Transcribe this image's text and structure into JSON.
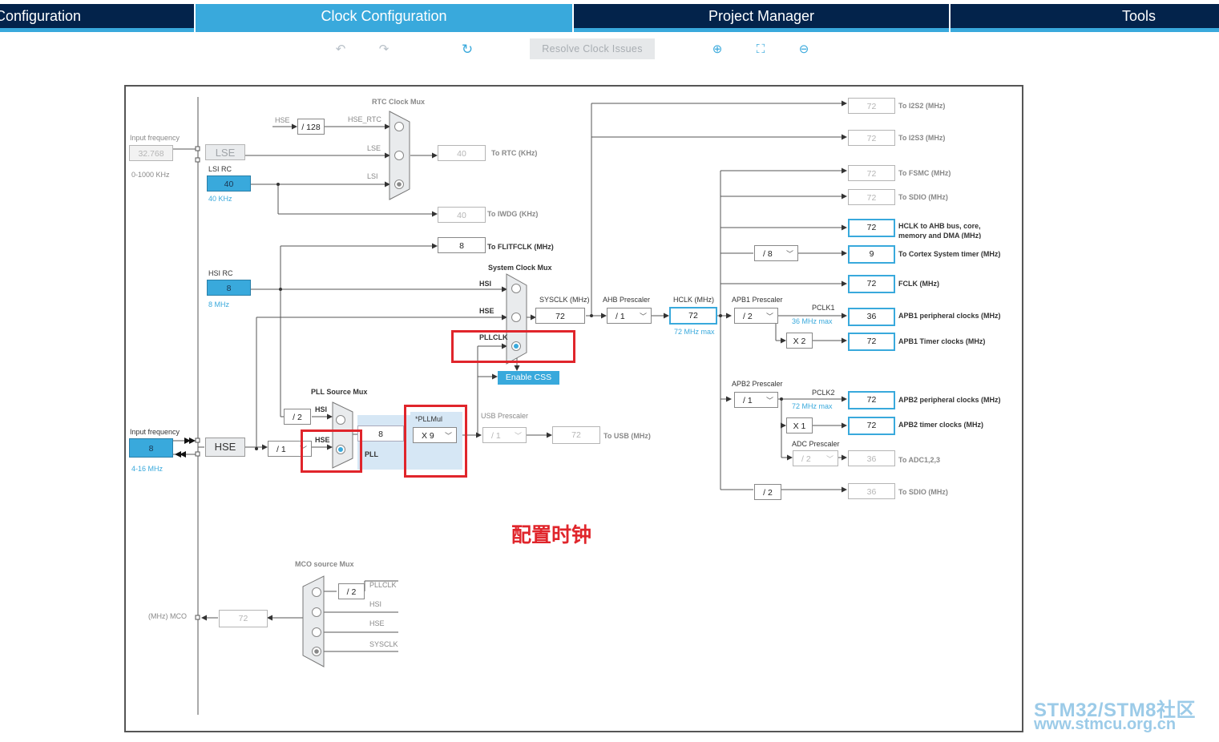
{
  "tabs": [
    {
      "label": "Configuration"
    },
    {
      "label": "Clock Configuration"
    },
    {
      "label": "Project Manager"
    },
    {
      "label": "Tools"
    }
  ],
  "toolbar": {
    "resolve_label": "Resolve Clock Issues",
    "icons": [
      "undo-icon",
      "redo-icon",
      "refresh-icon",
      "zoom-in-icon",
      "fit-screen-icon",
      "zoom-out-icon"
    ]
  },
  "lse": {
    "input_label": "Input frequency",
    "input_value": "32.768",
    "range": "0-1000 KHz",
    "name": "LSE"
  },
  "lsi": {
    "title": "LSI RC",
    "value": "40",
    "freq": "40 KHz"
  },
  "rtc": {
    "title": "RTC Clock Mux",
    "hse_label": "HSE",
    "div": "/ 128",
    "hse_rtc": "HSE_RTC",
    "lse_label": "LSE",
    "lsi_label": "LSI",
    "out_value": "40",
    "out_label": "To RTC (KHz)",
    "iwdg_value": "40",
    "iwdg_label": "To IWDG (KHz)"
  },
  "flitf": {
    "value": "8",
    "label": "To FLITFCLK (MHz)"
  },
  "hsi": {
    "title": "HSI RC",
    "value": "8",
    "freq": "8 MHz"
  },
  "sysmux": {
    "title": "System Clock Mux",
    "hsi": "HSI",
    "hse": "HSE",
    "pllclk": "PLLCLK",
    "enable_css": "Enable CSS"
  },
  "sysclk": {
    "label": "SYSCLK (MHz)",
    "value": "72"
  },
  "ahb": {
    "label": "AHB Prescaler",
    "value": "/ 1"
  },
  "hclk": {
    "label": "HCLK (MHz)",
    "value": "72",
    "max": "72 MHz max"
  },
  "apb1": {
    "label": "APB1 Prescaler",
    "value": "/ 2",
    "pclk": "PCLK1",
    "max": "36 MHz max",
    "timer_mul": "X 2"
  },
  "apb2": {
    "label": "APB2 Prescaler",
    "value": "/ 1",
    "pclk": "PCLK2",
    "max": "72 MHz max",
    "timer_mul": "X 1"
  },
  "adc": {
    "label": "ADC Prescaler",
    "value": "/ 2"
  },
  "cortex_div": "/ 8",
  "sdio_div": "/ 2",
  "outputs": [
    {
      "value": "72",
      "label": "To I2S2 (MHz)"
    },
    {
      "value": "72",
      "label": "To I2S3 (MHz)"
    },
    {
      "value": "72",
      "label": "To FSMC (MHz)"
    },
    {
      "value": "72",
      "label": "To SDIO (MHz)"
    },
    {
      "value": "72",
      "label": "HCLK to AHB bus, core,"
    },
    {
      "value": "9",
      "label": "To Cortex System timer (MHz)"
    },
    {
      "value": "72",
      "label": "FCLK (MHz)"
    },
    {
      "value": "36",
      "label": "APB1 peripheral clocks (MHz)"
    },
    {
      "value": "72",
      "label": "APB1 Timer clocks (MHz)"
    },
    {
      "value": "72",
      "label": "APB2 peripheral clocks (MHz)"
    },
    {
      "value": "72",
      "label": "APB2 timer clocks (MHz)"
    },
    {
      "value": "36",
      "label": "To ADC1,2,3"
    },
    {
      "value": "36",
      "label": "To SDIO (MHz)"
    }
  ],
  "hclk_label_line2": "memory and DMA (MHz)",
  "hse": {
    "input_label": "Input frequency",
    "value": "8",
    "range": "4-16 MHz",
    "name": "HSE"
  },
  "pll": {
    "source_title": "PLL Source Mux",
    "hsi_div": "/ 2",
    "hsi": "HSI",
    "hse": "HSE",
    "hse_div": "/ 1",
    "value": "8",
    "pll": "PLL",
    "mul_label": "*PLLMul",
    "mul_value": "X 9"
  },
  "usb": {
    "label": "USB Prescaler",
    "value": "/ 1",
    "out_value": "72",
    "out_label": "To USB (MHz)"
  },
  "mco": {
    "title": "MCO source Mux",
    "div": "/ 2",
    "pllclk": "PLLCLK",
    "hsi": "HSI",
    "hse": "HSE",
    "sysclk": "SYSCLK",
    "value": "72",
    "label": "(MHz) MCO"
  },
  "annotation": "配置时钟",
  "watermark": {
    "line1": "STM32/STM8社区",
    "line2": "www.stmcu.org.cn"
  },
  "colors": {
    "accent": "#39a9dc",
    "navy": "#03234b",
    "red": "#e0252b"
  }
}
